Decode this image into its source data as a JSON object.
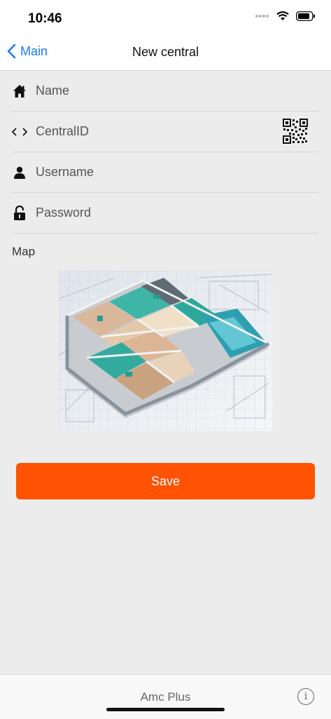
{
  "status_bar": {
    "time": "10:46"
  },
  "nav": {
    "back_label": "Main",
    "title": "New central"
  },
  "form": {
    "name_placeholder": "Name",
    "central_id_placeholder": "CentralID",
    "username_placeholder": "Username",
    "password_placeholder": "Password"
  },
  "map": {
    "label": "Map"
  },
  "actions": {
    "save_label": "Save"
  },
  "footer": {
    "app_name": "Amc Plus"
  },
  "colors": {
    "accent": "#1a7cf5",
    "save_button": "#ff5203"
  }
}
